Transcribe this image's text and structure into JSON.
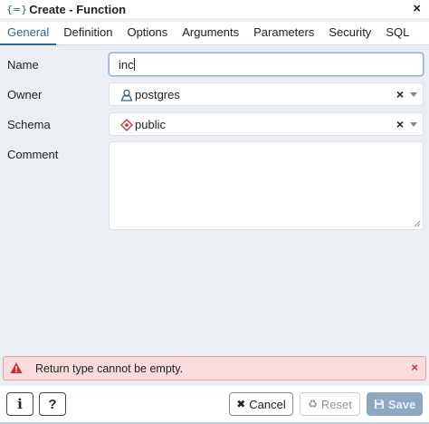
{
  "window": {
    "title": "Create - Function",
    "title_icon": "{=}",
    "close_label": "×"
  },
  "tabs": [
    "General",
    "Definition",
    "Options",
    "Arguments",
    "Parameters",
    "Security",
    "SQL"
  ],
  "active_tab": "General",
  "form": {
    "name_label": "Name",
    "name_value": "inc",
    "owner_label": "Owner",
    "owner_value": "postgres",
    "schema_label": "Schema",
    "schema_value": "public",
    "comment_label": "Comment",
    "comment_value": "",
    "clear_glyph": "×"
  },
  "error": {
    "message": "Return type cannot be empty.",
    "close_glyph": "×"
  },
  "footer": {
    "info_label": "i",
    "help_label": "?",
    "cancel_label": "Cancel",
    "reset_label": "Reset",
    "save_label": "Save"
  },
  "colors": {
    "accent": "#326690",
    "error_bg": "#fadcdc",
    "error_icon": "#c83030",
    "save_bg": "#8ea8c4"
  }
}
